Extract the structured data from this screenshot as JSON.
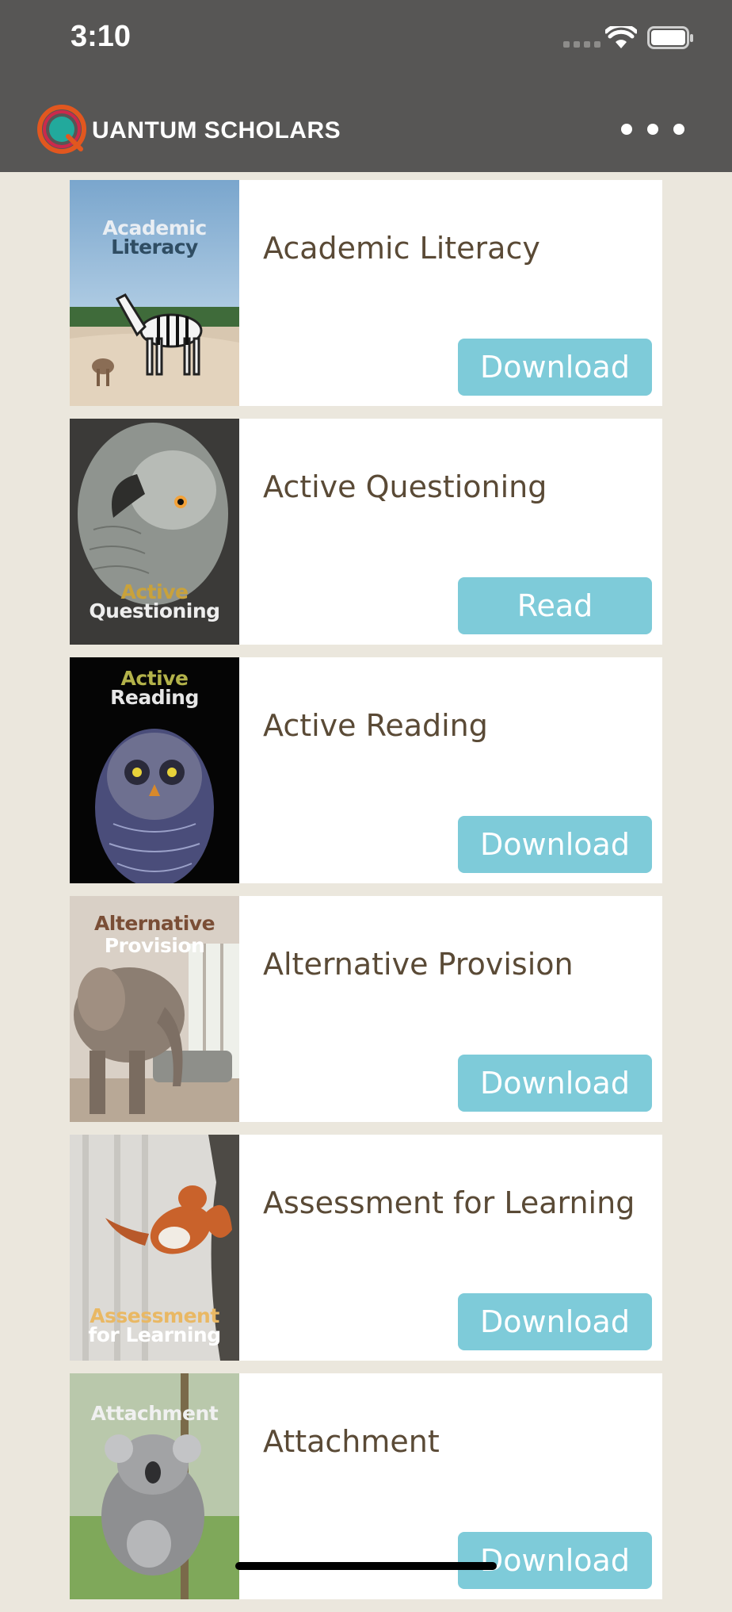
{
  "status_bar": {
    "time": "3:10"
  },
  "header": {
    "app_name": "UANTUM SCHOLARS",
    "brand_colors": {
      "ring_orange": "#e2571f",
      "ring_red": "#d9254a",
      "core_teal": "#22a99c"
    }
  },
  "books": [
    {
      "title": "Academic Literacy",
      "cover_line1": "Academic",
      "cover_line2": "Literacy",
      "action": "Download"
    },
    {
      "title": "Active Questioning",
      "cover_line1": "Active",
      "cover_line2": "Questioning",
      "action": "Read"
    },
    {
      "title": "Active Reading",
      "cover_line1": "Active",
      "cover_line2": "Reading",
      "action": "Download"
    },
    {
      "title": "Alternative Provision",
      "cover_line1": "Alternative",
      "cover_line2": "Provision",
      "action": "Download"
    },
    {
      "title": "Assessment for Learning",
      "cover_line1": "Assessment",
      "cover_line2": "for Learning",
      "action": "Download"
    },
    {
      "title": "Attachment",
      "cover_line1": "Attachment",
      "cover_line2": "",
      "action": "Download"
    }
  ],
  "colors": {
    "header_bg": "#575655",
    "page_bg": "#ebe7dd",
    "button_bg": "#7ecbd9",
    "title_text": "#5a4a36"
  }
}
